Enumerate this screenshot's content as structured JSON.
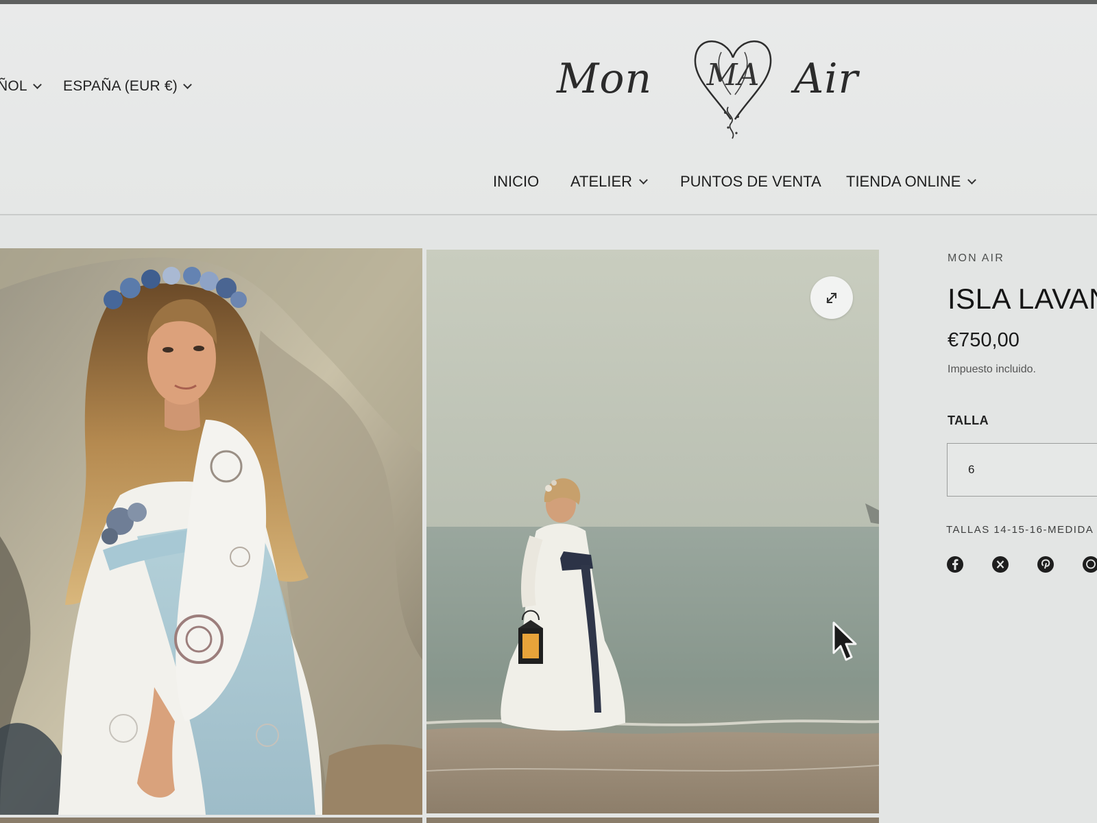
{
  "header": {
    "language_label": "ESPAÑOL",
    "language_visible": "ÑOL",
    "country_label": "ESPAÑA (EUR €)",
    "logo": {
      "text_left": "Mon",
      "text_right": "Air",
      "monogram": "MA"
    },
    "nav": [
      {
        "label": "INICIO",
        "dropdown": false
      },
      {
        "label": "ATELIER",
        "dropdown": true
      },
      {
        "label": "PUNTOS DE VENTA",
        "dropdown": false
      },
      {
        "label": "TIENDA ONLINE",
        "dropdown": true
      }
    ]
  },
  "gallery": {
    "zoom_icon": "expand-icon"
  },
  "product": {
    "vendor": "MON AIR",
    "title": "ISLA LAVANI",
    "price": "€750,00",
    "tax_note": "Impuesto incluido.",
    "size_label": "TALLA",
    "size_value": "6",
    "size_note": "TALLAS 14-15-16-MEDIDA",
    "share_icons": [
      "facebook-icon",
      "x-icon",
      "pinterest-icon",
      "whatsapp-icon"
    ]
  },
  "colors": {
    "page_bg": "#e3e5e4",
    "text": "#1f2020",
    "accent_dark": "#151515"
  }
}
